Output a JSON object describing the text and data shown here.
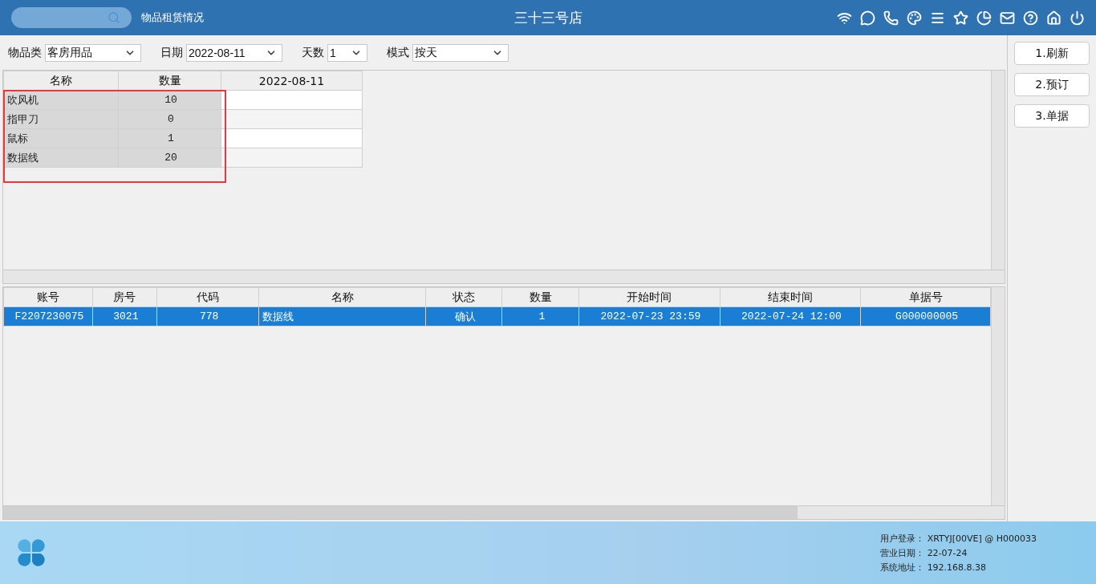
{
  "header": {
    "page_title": "物品租赁情况",
    "store_name": "三十三号店"
  },
  "filters": [
    {
      "label": "物品类",
      "value": "客房用品"
    },
    {
      "label": "日期",
      "value": "2022-08-11"
    },
    {
      "label": "天数",
      "value": "1"
    },
    {
      "label": "模式",
      "value": "按天"
    }
  ],
  "summary_table": {
    "columns": [
      "名称",
      "数量",
      "2022-08-11"
    ],
    "rows": [
      {
        "cells": [
          "吹风机",
          "10",
          ""
        ]
      },
      {
        "cells": [
          "指甲刀",
          "0",
          ""
        ]
      },
      {
        "cells": [
          "鼠标",
          "1",
          ""
        ]
      },
      {
        "cells": [
          "数据线",
          "20",
          ""
        ]
      }
    ]
  },
  "orders_table": {
    "columns": [
      "账号",
      "房号",
      "代码",
      "名称",
      "状态",
      "数量",
      "开始时间",
      "结束时间",
      "单据号"
    ],
    "rows": [
      {
        "selected": true,
        "cells": [
          "F2207230075",
          "3021",
          "778",
          "数据线",
          "确认",
          "1",
          "2022-07-23 23:59",
          "2022-07-24 12:00",
          "G000000005"
        ]
      }
    ]
  },
  "buttons": [
    "1.刷新",
    "2.预订",
    "3.单据"
  ],
  "footer": [
    {
      "label": "用户登录：",
      "value": "XRTYJ[00VE] @ H000033"
    },
    {
      "label": "营业日期：",
      "value": "22-07-24"
    },
    {
      "label": "系统地址：",
      "value": "192.168.8.38"
    }
  ]
}
